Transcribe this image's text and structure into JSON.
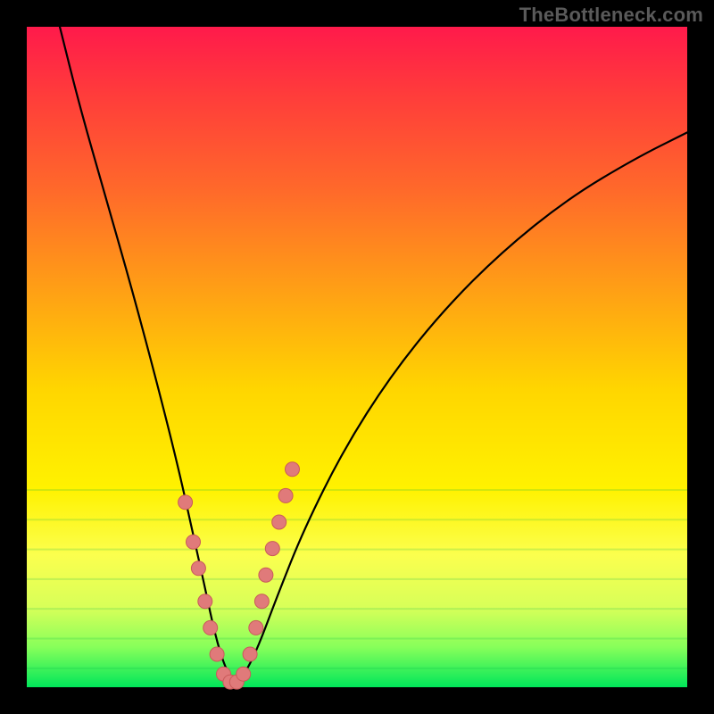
{
  "watermark": "TheBottleneck.com",
  "colors": {
    "dot_fill": "#e07a7a",
    "dot_stroke": "#c95a5a",
    "curve": "#000000",
    "frame": "#000000"
  },
  "chart_data": {
    "type": "line",
    "title": "",
    "xlabel": "",
    "ylabel": "",
    "xlim": [
      0,
      100
    ],
    "ylim": [
      0,
      100
    ],
    "grid": false,
    "legend": false,
    "series": [
      {
        "name": "bottleneck-curve",
        "x": [
          5,
          8,
          12,
          16,
          20,
          23,
          25,
          27,
          28.5,
          30,
          31.5,
          33,
          35,
          38,
          42,
          48,
          55,
          63,
          72,
          82,
          92,
          100
        ],
        "y": [
          100,
          88,
          74,
          60,
          45,
          33,
          24,
          15,
          8,
          3,
          0.5,
          2,
          6,
          14,
          24,
          36,
          47,
          57,
          66,
          74,
          80,
          84
        ]
      }
    ],
    "highlight_points": {
      "name": "dots",
      "x": [
        24.0,
        25.2,
        26.0,
        27.0,
        27.8,
        28.8,
        29.8,
        30.8,
        31.8,
        32.8,
        33.8,
        34.7,
        35.6,
        36.2,
        37.2,
        38.2,
        39.2,
        40.2
      ],
      "y": [
        28.0,
        22.0,
        18.0,
        13.0,
        9.0,
        5.0,
        2.0,
        0.8,
        0.8,
        2.0,
        5.0,
        9.0,
        13.0,
        17.0,
        21.0,
        25.0,
        29.0,
        33.0
      ],
      "r": 8
    },
    "green_band_lines_y": [
      73,
      76,
      79,
      82,
      85,
      88,
      91
    ]
  }
}
